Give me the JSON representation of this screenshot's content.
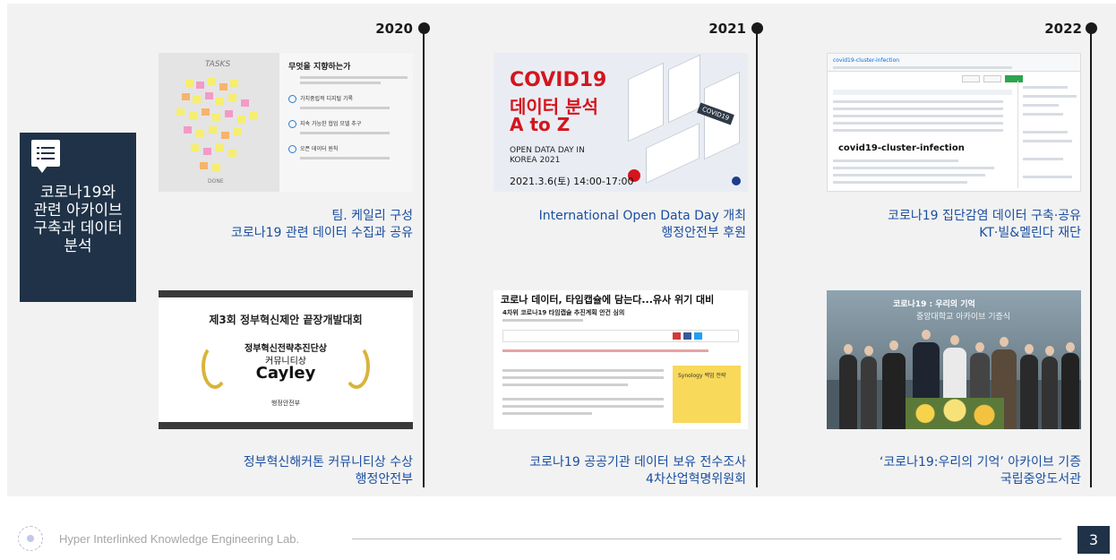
{
  "sidebar": {
    "title": "코로나19와\n관련 아카이브\n구축과 데이터\n분석",
    "icon": "document-list-icon"
  },
  "timeline": {
    "years": [
      "2020",
      "2021",
      "2022"
    ],
    "items": [
      {
        "caption": "팀. 케일리 구성\n코로나19 관련 데이터 수집과 공유",
        "thumb": {
          "wall_label_1": "TASKS",
          "wall_label_2": "DONE",
          "heading": "무엇을 지향하는가",
          "point1": "가치중립적 디지털 기록",
          "point2": "지속 가능한 협업 모델 추구",
          "point3": "오픈 데이터 원칙"
        }
      },
      {
        "caption": "International Open Data Day 개최\n행정안전부 후원",
        "thumb": {
          "line1": "COVID19",
          "line2": "데이터 분석",
          "line3": "A to Z",
          "line4": "OPEN DATA DAY IN\nKOREA 2021",
          "line5": "2021.3.6(토) 14:00-17:00",
          "tag": "COVID19"
        }
      },
      {
        "caption": "코로나19 집단감염 데이터 구축·공유\nKT·빌&멜린다 재단",
        "thumb": {
          "repo": "covid19-cluster-infection",
          "readme_title": "covid19-cluster-infection"
        }
      },
      {
        "caption": "정부혁신해커톤 커뮤니티상 수상\n행정안전부",
        "thumb": {
          "event": "제3회 정부혁신제안 끝장개발대회",
          "award": "정부혁신전략추진단상",
          "award_type": "커뮤니티상",
          "team": "Cayley",
          "org": "행정안전부"
        }
      },
      {
        "caption": "코로나19 공공기관 데이터 보유 전수조사\n4차산업혁명위원회",
        "thumb": {
          "headline": "코로나 데이터, 타임캡슐에 담는다...유사 위기 대비",
          "subhead": "4차위 코로나19 타임캡슐 추진계획 안건 심의",
          "ad": "Synology 백업 전략"
        }
      },
      {
        "caption": "‘코로나19:우리의 기억’ 아카이브 기증\n국립중앙도서관",
        "thumb": {
          "banner1": "코로나19 : 우리의 기억",
          "banner2": "중앙대학교 아카이브 기증식"
        }
      }
    ]
  },
  "footer": {
    "lab": "Hyper Interlinked Knowledge Engineering Lab.",
    "page": "3"
  },
  "colors": {
    "accent": "#1f3247",
    "caption": "#1b4fa0",
    "panel": "#f2f2f2"
  }
}
